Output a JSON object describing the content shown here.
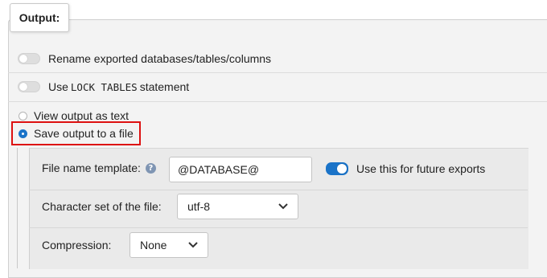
{
  "section": {
    "title": "Output:"
  },
  "options": {
    "rename_exported": {
      "label": "Rename exported databases/tables/columns",
      "on": false
    },
    "lock_tables": {
      "prefix": "Use ",
      "code": "LOCK TABLES",
      "suffix": " statement",
      "on": false
    }
  },
  "output_mode": {
    "view_as_text": {
      "label": "View output as text",
      "selected": false
    },
    "save_to_file": {
      "label": "Save output to a file",
      "selected": true
    }
  },
  "file_settings": {
    "file_name_template": {
      "label": "File name template:",
      "value": "@DATABASE@",
      "help_icon": "question-circle-icon"
    },
    "future_exports": {
      "label": "Use this for future exports",
      "on": true
    },
    "charset": {
      "label": "Character set of the file:",
      "selected": "utf-8"
    },
    "compression": {
      "label": "Compression:",
      "selected": "None"
    }
  },
  "colors": {
    "accent": "#1a73c8",
    "highlight": "#dd1111"
  }
}
